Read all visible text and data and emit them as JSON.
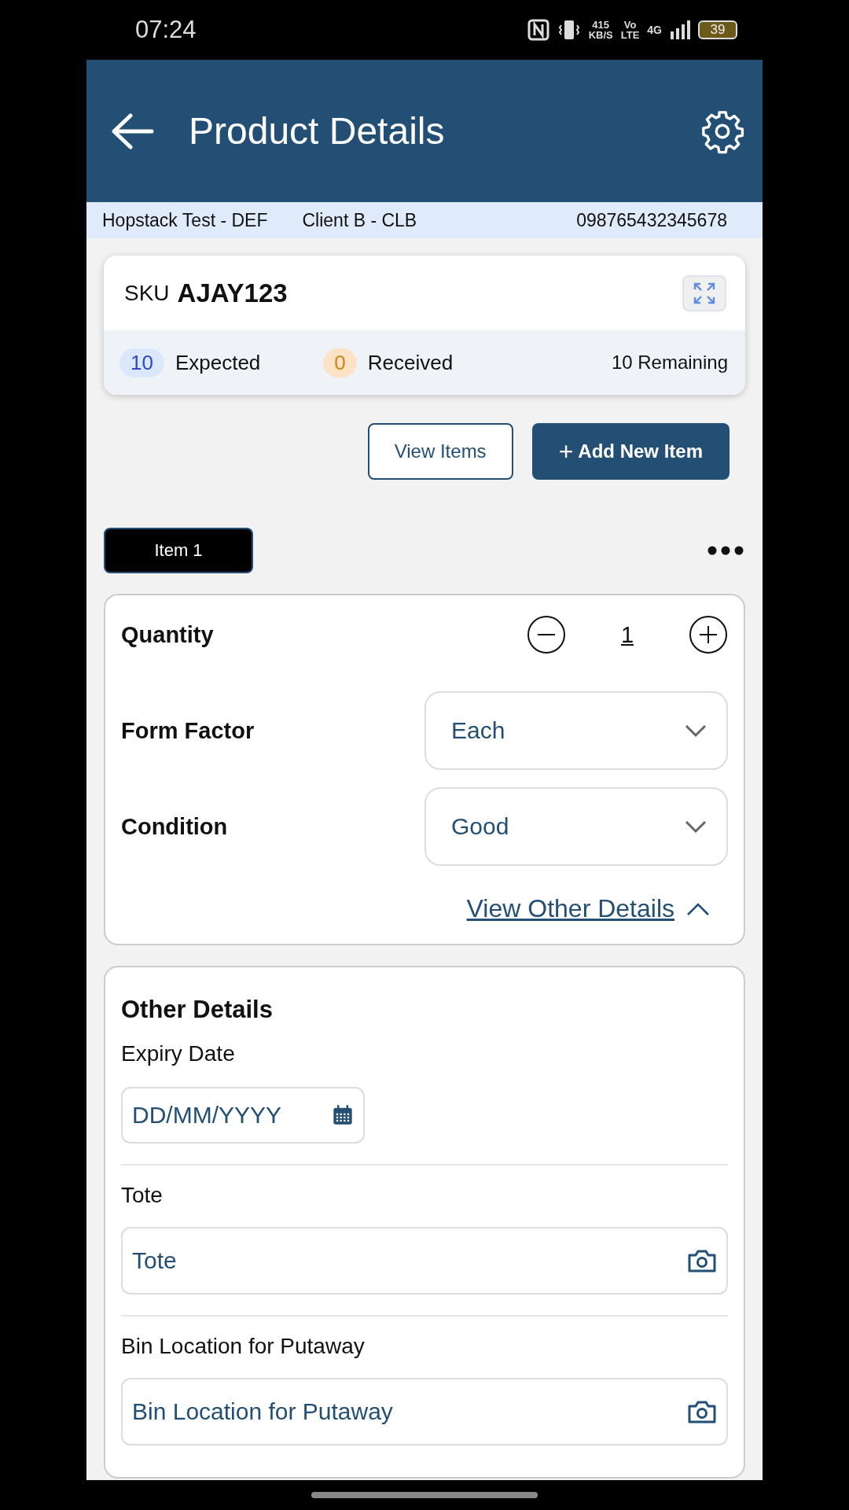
{
  "status_bar": {
    "time": "07:24",
    "speed": "415",
    "speed_unit": "KB/S",
    "volte_top": "Vo",
    "volte_bottom": "LTE",
    "network": "4G",
    "battery": "39"
  },
  "header": {
    "title": "Product Details"
  },
  "info_strip": {
    "warehouse": "Hopstack Test - DEF",
    "client": "Client B - CLB",
    "code": "098765432345678"
  },
  "sku_card": {
    "sku_label": "SKU",
    "sku": "AJAY123",
    "expected_count": "10",
    "expected_label": "Expected",
    "received_count": "0",
    "received_label": "Received",
    "remaining": "10 Remaining"
  },
  "actions": {
    "view_items": "View Items",
    "add_item_icon": "+",
    "add_item": "Add New Item"
  },
  "item_tabs": [
    {
      "label": "Item 1",
      "selected": true
    }
  ],
  "item_card": {
    "quantity_label": "Quantity",
    "quantity": "1",
    "form_factor_label": "Form Factor",
    "form_factor": "Each",
    "condition_label": "Condition",
    "condition": "Good",
    "toggle_link": "View Other Details",
    "expanded": true
  },
  "other_details": {
    "title": "Other Details",
    "fields": [
      {
        "kind": "date",
        "label": "Expiry Date",
        "placeholder": "DD/MM/YYYY"
      },
      {
        "kind": "scan",
        "label": "Tote",
        "placeholder": "Tote"
      },
      {
        "kind": "scan",
        "label": "Bin Location for Putaway",
        "placeholder": "Bin Location for Putaway"
      }
    ]
  }
}
